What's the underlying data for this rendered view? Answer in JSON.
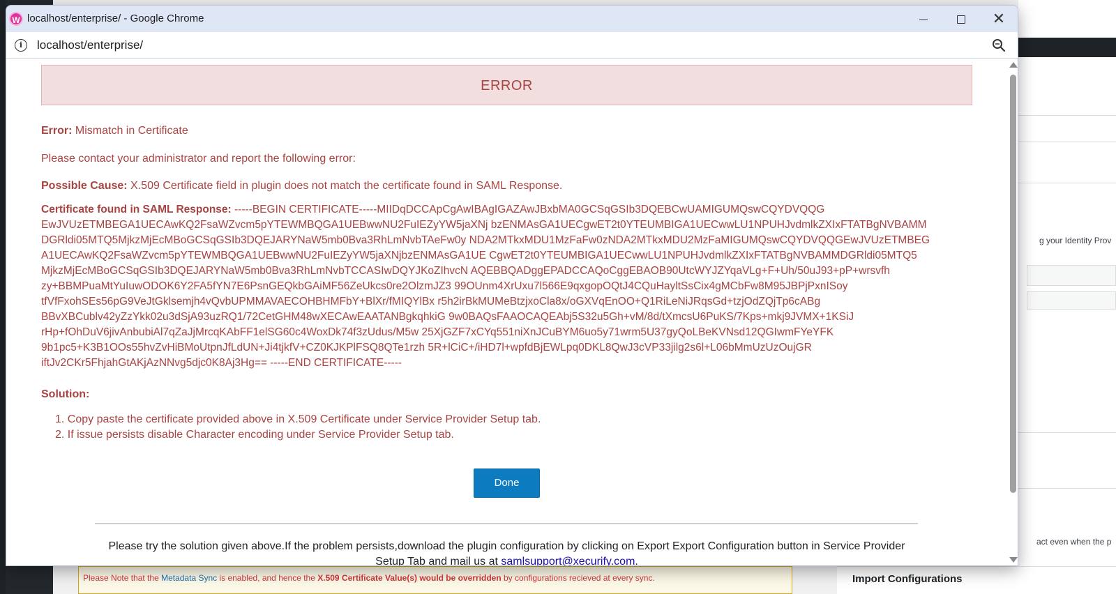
{
  "window": {
    "title": "localhost/enterprise/ - Google Chrome",
    "favicon": "W",
    "url": "localhost/enterprise/"
  },
  "page": {
    "banner": "ERROR",
    "error_label": "Error:",
    "error_text": " Mismatch in Certificate",
    "contact_text": "Please contact your administrator and report the following error:",
    "cause_label": "Possible Cause:",
    "cause_text": " X.509 Certificate field in plugin does not match the certificate found in SAML Response.",
    "cert_label": "Certificate found in SAML Response:",
    "cert_lines": [
      " -----BEGIN CERTIFICATE-----MIIDqDCCApCgAwIBAgIGAZAwJBxbMA0GCSqGSIb3DQEBCwUAMIGUMQswCQYDVQQG",
      "EwJVUzETMBEGA1UECAwKQ2FsaWZvcm5pYTEWMBQGA1UEBwwNU2FuIEZyYW5jaXNj bzENMAsGA1UECgwET2t0YTEUMBIGA1UECwwLU1NPUHJvdmlkZXIxFTATBgNVBAMM",
      "DGRldi05MTQ5MjkzMjEcMBoGCSqGSIb3DQEJARYNaW5mb0Bva3RhLmNvbTAeFw0y NDA2MTkxMDU1MzFaFw0zNDA2MTkxMDU2MzFaMIGUMQswCQYDVQQGEwJVUzETMBEG",
      "A1UECAwKQ2FsaWZvcm5pYTEWMBQGA1UEBwwNU2FuIEZyYW5jaXNjbzENMAsGA1UE CgwET2t0YTEUMBIGA1UECwwLU1NPUHJvdmlkZXIxFTATBgNVBAMMDGRldi05MTQ5",
      "MjkzMjEcMBoGCSqGSIb3DQEJARYNaW5mb0Bva3RhLmNvbTCCASIwDQYJKoZIhvcN AQEBBQADggEPADCCAQoCggEBAOB90UtcWYJZYqaVLg+F+Uh/50uJ93+pP+wrsvfh",
      "zy+BBMPuaMtYuIuwODOK6Y2FA5fYN7E6PsnGEQkbGAiMF56ZeUkcs0re2OlzmJZ3 99OUnm4XrUxu7l566E9qxgopOQtJ4CQuHayltSsCix4gMCbFw8M95JBPjPxnISoy",
      "tfVfFxohSEs56pG9VeJtGklsemjh4vQvbUPMMAVAECOHBHMFbY+BlXr/fMIQYlBx r5h2irBkMUMeBtzjxoCla8x/oGXVqEnOO+Q1RiLeNiJRqsGd+tzjOdZQjTp6cABg",
      "BBvXBCublv42yZzYkk02u3dSjA93uzRQ1/72CetGHM48wXECAwEAATANBgkqhkiG 9w0BAQsFAAOCAQEAbj5S32u5Gh+vM/8d/tXmcsU6PuKS/7Kps+mkj9JVMX+1KSiJ",
      "rHp+fOhDuV6jivAnbubiAl7qZaJjMrcqKAbFF1elSG60c4WoxDk74f3zUdus/M5w 25XjGZF7xCYq551niXnJCuBYM6uo5y71wrm5U37gyQoLBeKVNsd12QGIwmFYeYFK",
      "9b1pc5+K3B1OOs55hvZvHiBMoUtpnJfLdUN+Ji4tjkfV+CZ0KJKPlFSQ8QTe1rzh 5R+lCiC+/iHD7l+wpfdBjEWLpq0DKL8QwJ3cVP33jilg2s6l+L06bMmUzUzOujGR",
      "iftJv2CKr5FhjahGtAKjAzNNvg5djc0K8Aj3Hg== -----END CERTIFICATE-----"
    ],
    "solution_label": "Solution:",
    "solutions": [
      "1. Copy paste the certificate provided above in X.509 Certificate under Service Provider Setup tab.",
      "2. If issue persists disable Character encoding under Service Provider Setup tab."
    ],
    "done_label": "Done",
    "footer_text": "Please try the solution given above.If the problem persists,download the plugin configuration by clicking on Export Export Configuration button in Service Provider Setup Tab and mail us at ",
    "footer_email": "samlsupport@xecurify.com",
    "footer_end": "."
  },
  "background": {
    "idp_text": "g your Identity Prov",
    "act_text": "act even when the p",
    "import_text": "Import Configurations",
    "notice_part1": "Please Note that the ",
    "notice_part2": "Metadata Sync",
    "notice_part3": " is enabled, and hence the ",
    "notice_part4": "X.509 Certificate Value(s) would be overridden",
    "notice_part5": " by configurations recieved at every sync."
  },
  "colors": {
    "error_text": "#a94442",
    "banner_bg": "#f2dede",
    "button_bg": "#0c7bbf",
    "titlebar_bg": "#dfe7f6"
  }
}
